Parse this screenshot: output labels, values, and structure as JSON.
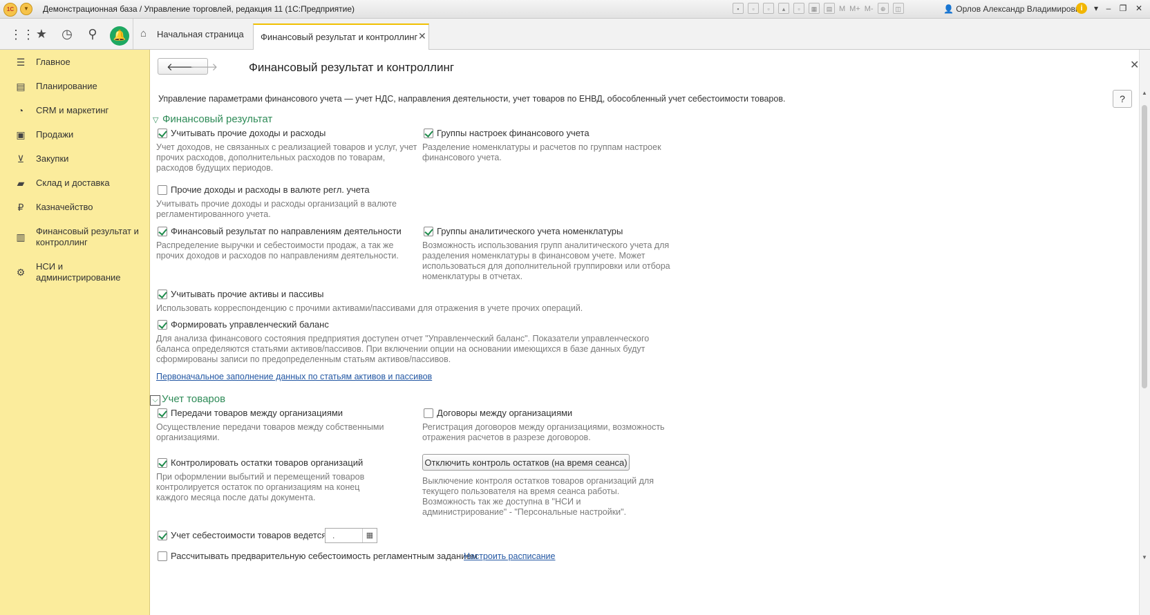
{
  "titlebar": {
    "logo": "1С",
    "title": "Демонстрационная база / Управление торговлей, редакция 11  (1С:Предприятие)",
    "user": "Орлов Александр Владимирович",
    "m_labels": [
      "M",
      "M+",
      "M-"
    ]
  },
  "tabs": {
    "home": "Начальная страница",
    "active": "Финансовый результат и контроллинг"
  },
  "sidebar": {
    "items": [
      {
        "label": "Главное",
        "icon": "menu-lines-icon"
      },
      {
        "label": "Планирование",
        "icon": "planning-icon"
      },
      {
        "label": "CRM и маркетинг",
        "icon": "pie-chart-icon"
      },
      {
        "label": "Продажи",
        "icon": "bag-icon"
      },
      {
        "label": "Закупки",
        "icon": "cart-icon"
      },
      {
        "label": "Склад и доставка",
        "icon": "truck-icon"
      },
      {
        "label": "Казначейство",
        "icon": "ruble-icon"
      },
      {
        "label": "Финансовый результат и контроллинг",
        "icon": "bar-chart-icon"
      },
      {
        "label": "НСИ и администрирование",
        "icon": "gear-icon"
      }
    ]
  },
  "main": {
    "title": "Финансовый результат и контроллинг",
    "description": "Управление параметрами финансового учета — учет НДС, направления деятельности, учет товаров по ЕНВД, обособленный учет себестоимости товаров.",
    "help": "?",
    "sections": {
      "fin": {
        "title": "Финансовый результат",
        "options": {
          "other_income": {
            "label": "Учитывать прочие доходы и расходы",
            "checked": true,
            "hint": "Учет доходов, не связанных с реализацией товаров и услуг, учет прочих расходов, дополнительных расходов по товарам, расходов будущих периодов."
          },
          "fin_groups": {
            "label": "Группы настроек финансового учета",
            "checked": true,
            "hint": "Разделение номенклатуры и расчетов по группам настроек финансового учета."
          },
          "currency": {
            "label": "Прочие доходы и расходы в валюте регл. учета",
            "checked": false,
            "hint": "Учитывать прочие доходы и расходы организаций в валюте регламентированного учета."
          },
          "by_direction": {
            "label": "Финансовый результат по направлениям деятельности",
            "checked": true,
            "hint": "Распределение выручки и себестоимости продаж, а так же прочих доходов и расходов по направлениям деятельности."
          },
          "analytic_groups": {
            "label": "Группы аналитического учета номенклатуры",
            "checked": true,
            "hint": "Возможность использования групп аналитического учета для разделения номенклатуры в финансовом учете. Может использоваться для дополнительной группировки или отбора номенклатуры в отчетах."
          },
          "assets": {
            "label": "Учитывать прочие активы и пассивы",
            "checked": true,
            "hint": "Использовать корреспонденцию с прочими активами/пассивами для отражения в учете прочих операций."
          },
          "balance": {
            "label": "Формировать управленческий баланс",
            "checked": true,
            "hint": "Для анализа финансового состояния предприятия доступен отчет \"Управленческий баланс\". Показатели управленческого баланса определяются статьями активов/пассивов. При включении опции на основании имеющихся в базе данных будут сформированы записи по предопределенным статьям активов/пассивов."
          }
        },
        "link": "Первоначальное заполнение данных по статьям активов и пассивов"
      },
      "goods": {
        "title": "Учет товаров",
        "options": {
          "transfer": {
            "label": "Передачи товаров между организациями",
            "checked": true,
            "hint": "Осуществление передачи товаров между собственными организациями."
          },
          "contracts": {
            "label": "Договоры между организациями",
            "checked": false,
            "hint": "Регистрация договоров между организациями, возможность отражения расчетов  в разрезе договоров."
          },
          "control": {
            "label": "Контролировать остатки товаров организаций",
            "checked": true,
            "hint": "При оформлении выбытий и перемещений товаров контролируется остаток по организациям на конец каждого месяца после даты документа."
          },
          "cost_from": {
            "label": "Учет себестоимости товаров ведется с",
            "checked": true,
            "date_value": "."
          },
          "prelim": {
            "label": "Рассчитывать предварительную себестоимость регламентным заданием",
            "checked": false
          }
        },
        "disable_button": "Отключить контроль остатков (на время сеанса)",
        "disable_hint": "Выключение контроля остатков товаров организаций для текущего пользователя на время сеанса работы.\n Возможность так же доступна в \"НСИ и администрирование\" - \"Персональные настройки\".",
        "schedule_link": "Настроить расписание"
      }
    }
  },
  "colors": {
    "sidebar_bg": "#fbec9c",
    "section_green": "#2e8b57",
    "check_green": "#1f8b4c",
    "bell_green": "#1ea861",
    "link": "#2357a3"
  }
}
